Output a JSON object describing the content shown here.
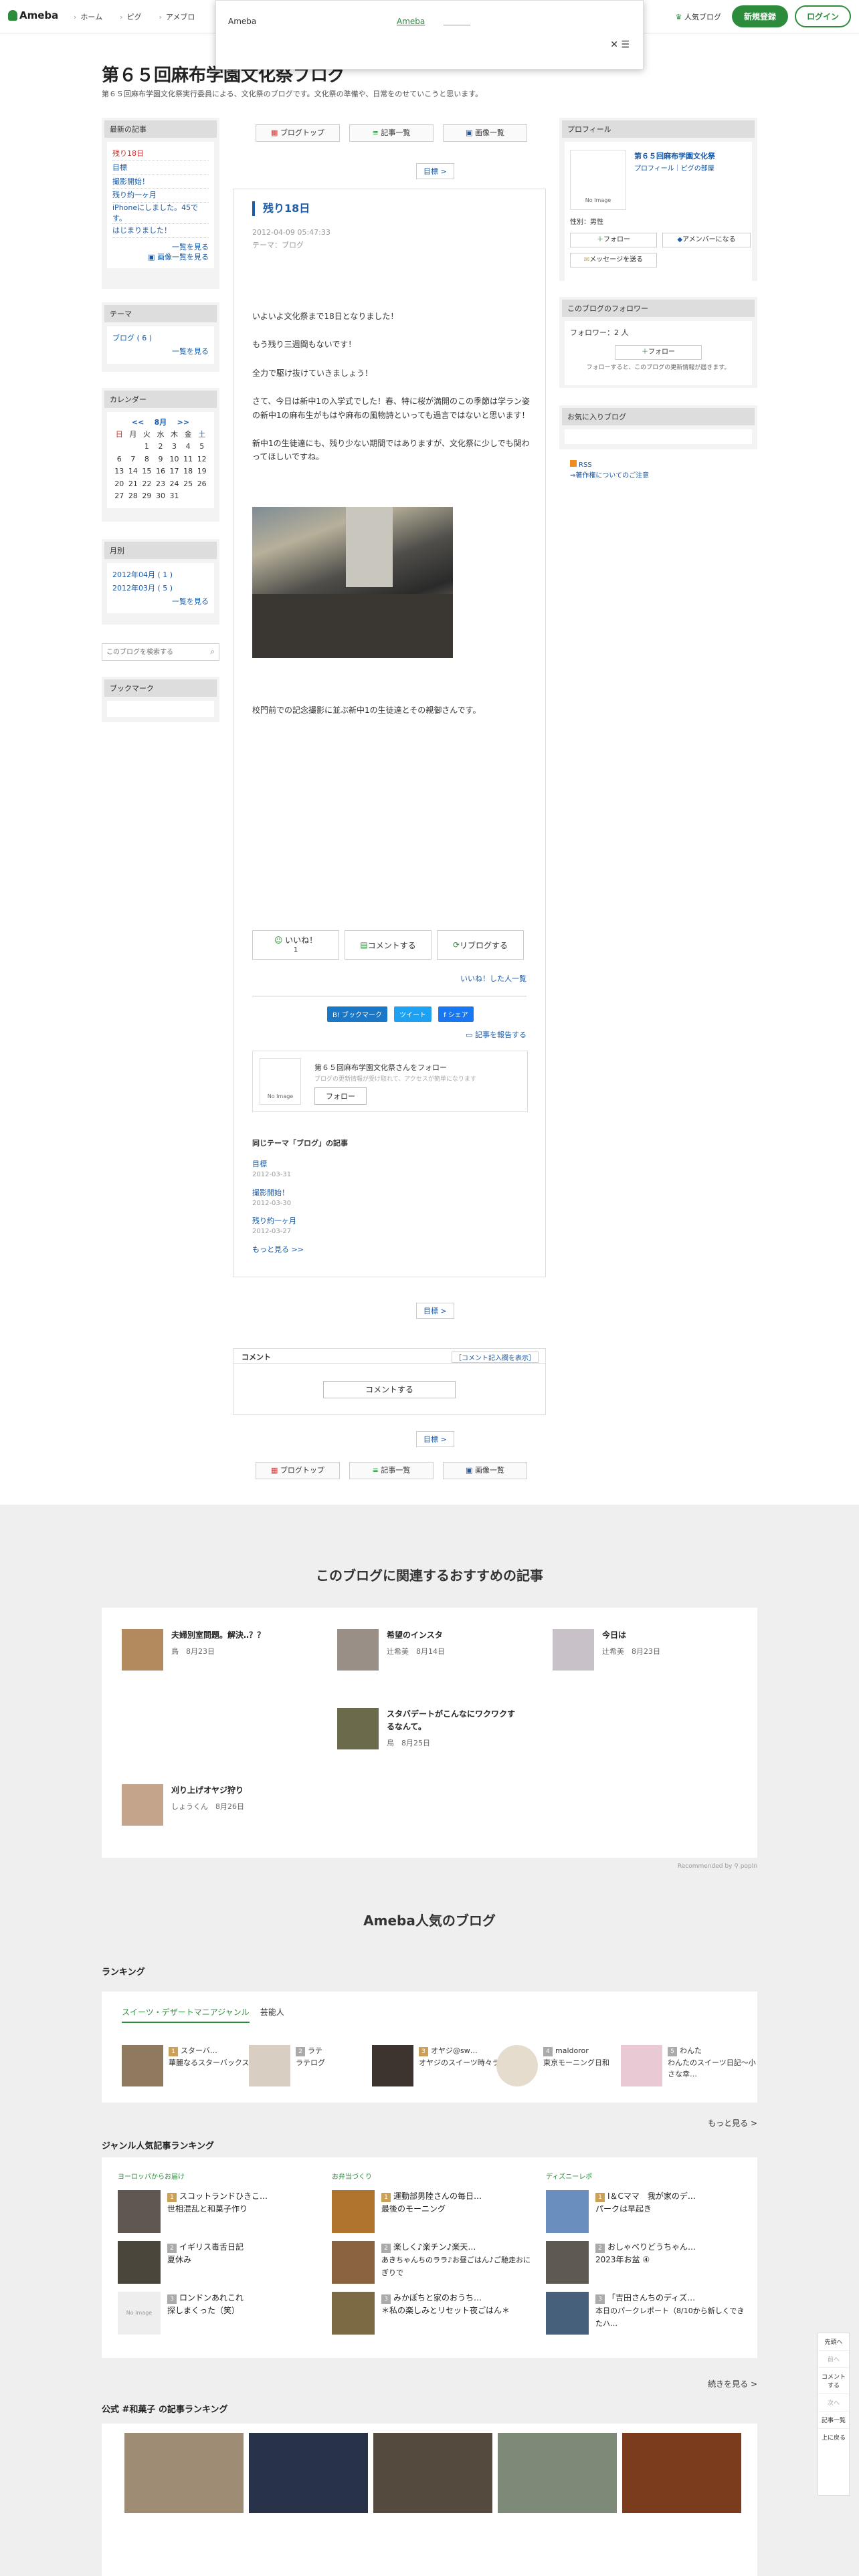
{
  "header": {
    "logo": "Ameba",
    "nav": [
      "ホーム",
      "ピグ",
      "アメブロ"
    ],
    "ranking": "人気ブログ",
    "signup": "新規登録",
    "login": "ログイン"
  },
  "popup": {
    "title": "Ameba",
    "link": "Ameba",
    "close": "✕"
  },
  "blog": {
    "title": "第６５回麻布学園文化祭ブログ",
    "desc": "第６５回麻布学園文化祭実行委員による、文化祭のブログです。文化祭の準備や、日常をのせていこうと思います。"
  },
  "left": {
    "recent_h": "最新の記事",
    "recent": [
      "残り18日",
      "目標",
      "撮影開始！",
      "残り約一ヶ月",
      "iPhoneにしました。45です。",
      "はじまりました！"
    ],
    "recent_more": "一覧を見る",
    "recent_img": "画像一覧を見る",
    "theme_h": "テーマ",
    "theme": "ブログ ( 6 )",
    "theme_more": "一覧を見る",
    "cal_h": "カレンダー",
    "cal_month": "<<    8月    >>",
    "cal_days": [
      "日",
      "月",
      "火",
      "水",
      "木",
      "金",
      "土"
    ],
    "cal_rows": [
      [
        "",
        "",
        "1",
        "2",
        "3",
        "4",
        "5"
      ],
      [
        "6",
        "7",
        "8",
        "9",
        "10",
        "11",
        "12"
      ],
      [
        "13",
        "14",
        "15",
        "16",
        "17",
        "18",
        "19"
      ],
      [
        "20",
        "21",
        "22",
        "23",
        "24",
        "25",
        "26"
      ],
      [
        "27",
        "28",
        "29",
        "30",
        "31",
        "",
        ""
      ]
    ],
    "month_h": "月別",
    "months": [
      "2012年04月 ( 1 )",
      "2012年03月 ( 5 )"
    ],
    "month_more": "一覧を見る",
    "search_ph": "このブログを検索する",
    "bookmark_h": "ブックマーク"
  },
  "right": {
    "profile_h": "プロフィール",
    "name": "第６５回麻布学園文化祭",
    "links": "プロフィール｜ピグの部屋",
    "noimage": "No Image",
    "sex": "性別：男性",
    "follow": "フォロー",
    "amember": "アメンバーになる",
    "message": "メッセージを送る",
    "follower_h": "このブログのフォロワー",
    "follower_count": "フォロワー：2 人",
    "follow2": "フォロー",
    "follower_note": "フォローすると、このブログの更新情報が届きます。",
    "fav_h": "お気に入りブログ",
    "rss": "RSS",
    "rss_note": "⇒著作権についてのご注意"
  },
  "toolbar": {
    "top": "ブログトップ",
    "list": "記事一覧",
    "img": "画像一覧",
    "next": "目標 >"
  },
  "article": {
    "title": "残り18日",
    "date": "2012-04-09 05:47:33",
    "theme": "テーマ：ブログ",
    "p1": "いよいよ文化祭まで18日となりました！",
    "p2": "もう残り三週間もないです！",
    "p3": "全力で駆け抜けていきましょう！",
    "p4": "さて、今日は新中1の入学式でした！春、特に桜が満開のこの季節は学ラン姿の新中1の麻布生がもはや麻布の風物詩といっても過言ではないと思います！",
    "p5": "新中1の生徒達にも、残り少ない期間ではありますが、文化祭に少しでも関わってほしいですね。",
    "caption": "校門前での記念撮影に並ぶ新中1の生徒達とその親御さんです。",
    "like": "いいね！",
    "like_count": "1",
    "comment": "コメントする",
    "reblog": "リブログする",
    "liked": "いいね！した人一覧",
    "bm": "B! ブックマーク",
    "tw": "ツイート",
    "fb": "f シェア",
    "report": "記事を報告する",
    "fbox_t": "第６５回麻布学園文化祭さんをフォロー",
    "fbox_s": "ブログの更新情報が受け取れて、アクセスが簡単になります",
    "fbox_b": "フォロー",
    "same_h": "同じテーマ「ブログ」の記事",
    "same": [
      {
        "t": "目標",
        "d": "2012-03-31"
      },
      {
        "t": "撮影開始！",
        "d": "2012-03-30"
      },
      {
        "t": "残り約一ヶ月",
        "d": "2012-03-27"
      }
    ],
    "same_more": "もっと見る >>"
  },
  "comments": {
    "h": "コメント",
    "r": "［コメント記入欄を表示］",
    "btn": "コメントする"
  },
  "rec": {
    "h": "このブログに関連するおすすめの記事",
    "items": [
      {
        "t": "夫婦別室問題。解決‥？？",
        "a": "鳥",
        "d": "8月23日"
      },
      {
        "t": "希望のインスタ",
        "a": "辻希美",
        "d": "8月14日"
      },
      {
        "t": "今日は",
        "a": "辻希美",
        "d": "8月23日"
      },
      {
        "t": "スタバデートがこんなにワクワクするなんて。",
        "a": "鳥",
        "d": "8月25日"
      },
      {
        "t": "刈り上げオヤジ狩り",
        "a": "しょうくん",
        "d": "8月26日"
      }
    ],
    "note": "Recommended by ⚲ popIn"
  },
  "popular": {
    "h": "Ameba人気のブログ",
    "rank_h": "ランキング",
    "tabs": [
      "スイーツ・デザートマニアジャンル",
      "芸能人"
    ],
    "rank": [
      {
        "n": "1",
        "t": "スターバ…",
        "s": "華麗なるスターバックスマダム"
      },
      {
        "n": "2",
        "t": "ラテ",
        "s": "ラテログ"
      },
      {
        "n": "3",
        "t": "オヤジ@sw…",
        "s": "オヤジのスイーツ時々ランニング…"
      },
      {
        "n": "4",
        "t": "maldoror",
        "s": "東京モーニング日和"
      },
      {
        "n": "5",
        "t": "わんた",
        "s": "わんたのスイーツ日記〜小さな幸…"
      }
    ],
    "more": "もっと見る  >",
    "genre_h": "ジャンル人気記事ランキング",
    "cols": [
      {
        "h": "ヨーロッパからお届け",
        "items": [
          {
            "n": "1",
            "t": "スコットランドひきこ…",
            "s": "世相混乱と和菓子作り"
          },
          {
            "n": "2",
            "t": "イギリス毒舌日記",
            "s": "夏休み"
          },
          {
            "n": "3",
            "t": "ロンドンあれこれ",
            "s": "探しまくった（笑）"
          }
        ]
      },
      {
        "h": "お弁当づくり",
        "items": [
          {
            "n": "1",
            "t": "運動部男陸さんの毎日…",
            "s": "最後のモーニング"
          },
          {
            "n": "2",
            "t": "楽しく♪楽チン♪楽天…",
            "s": "あきちゃんちのララ♪お昼ごはん♪ご馳走おにぎりで"
          },
          {
            "n": "3",
            "t": "みかぽちと家のおうち…",
            "s": "＊私の楽しみとリセット夜ごはん＊"
          }
        ]
      },
      {
        "h": "ディズニーレポ",
        "items": [
          {
            "n": "1",
            "t": "I＆Cママ　我が家のデ…",
            "s": "パークは早起き"
          },
          {
            "n": "2",
            "t": "おしゃべりどうちゃん…",
            "s": "2023年お盆 ④"
          },
          {
            "n": "3",
            "t": "「吉田さんちのディズ…",
            "s": "本日のパークレポート（8/10から新しくできたハ…"
          }
        ]
      }
    ],
    "more2": "続きを見る  >",
    "official_h": "公式 #和菓子 の記事ランキング",
    "noimage": "No Image"
  },
  "floatbar": [
    "先頭へ",
    "前へ",
    "コメントする",
    "次へ",
    "記事一覧",
    "上に戻る"
  ]
}
